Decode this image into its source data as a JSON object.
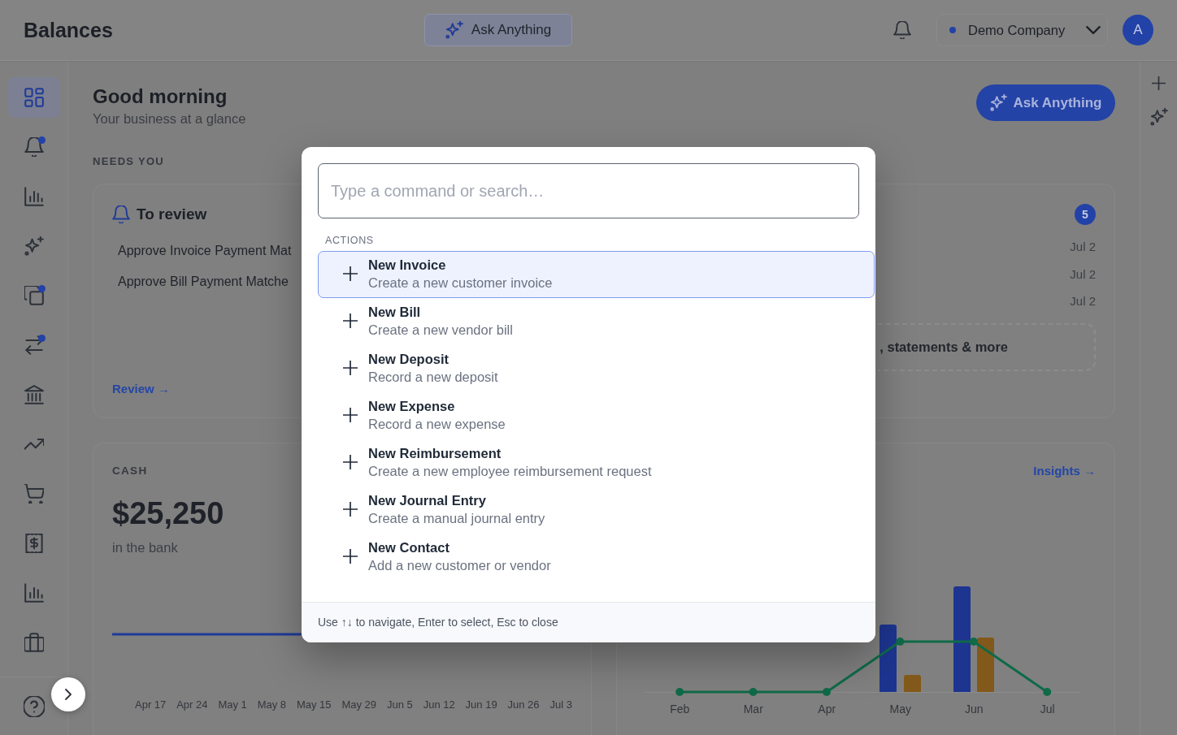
{
  "header": {
    "title": "Balances",
    "ask_button": "Ask Anything",
    "company_selector": "Demo Company",
    "avatar": "A"
  },
  "sidebar": {
    "items": [
      {
        "selected": true,
        "notification_dot": false
      },
      {
        "selected": false,
        "notification_dot": true
      },
      {
        "selected": false,
        "notification_dot": false
      },
      {
        "selected": false,
        "notification_dot": false
      },
      {
        "selected": false,
        "notification_dot": true
      },
      {
        "selected": false,
        "notification_dot": true
      },
      {
        "selected": false,
        "notification_dot": false
      },
      {
        "selected": false,
        "notification_dot": false
      },
      {
        "selected": false,
        "notification_dot": false
      },
      {
        "selected": false,
        "notification_dot": false
      },
      {
        "selected": false,
        "notification_dot": false
      },
      {
        "selected": false,
        "notification_dot": false
      }
    ]
  },
  "greeting": {
    "title": "Good morning",
    "subtitle": "Your business at a glance",
    "ask_button": "Ask Anything"
  },
  "needs_you": {
    "heading": "NEEDS YOU",
    "review_card": {
      "title": "To review",
      "items": [
        "Approve Invoice Payment Mat",
        "Approve Bill Payment Matche"
      ],
      "link": "Review →"
    },
    "card_2": {
      "badge": "5",
      "dates": [
        "Jul 2",
        "Jul 2",
        "Jul 2"
      ],
      "drop_zone_text": ", statements & more"
    }
  },
  "cash_card": {
    "label": "CASH",
    "amount": "$25,250",
    "caption": "in the bank",
    "x_labels": [
      "Apr 17",
      "Apr 24",
      "May 1",
      "May 8",
      "May 15",
      "May 29",
      "Jun 5",
      "Jun 12",
      "Jun 19",
      "Jun 26",
      "Jul 3"
    ]
  },
  "chart_card": {
    "link": "Insights →",
    "x_labels": [
      "Feb",
      "Mar",
      "Apr",
      "May",
      "Jun",
      "Jul"
    ]
  },
  "command_palette": {
    "placeholder": "Type a command or search…",
    "section": "ACTIONS",
    "items": [
      {
        "title": "New Invoice",
        "description": "Create a new customer invoice",
        "selected": true
      },
      {
        "title": "New Bill",
        "description": "Create a new vendor bill",
        "selected": false
      },
      {
        "title": "New Deposit",
        "description": "Record a new deposit",
        "selected": false
      },
      {
        "title": "New Expense",
        "description": "Record a new expense",
        "selected": false
      },
      {
        "title": "New Reimbursement",
        "description": "Create a new employee reimbursement request",
        "selected": false
      },
      {
        "title": "New Journal Entry",
        "description": "Create a manual journal entry",
        "selected": false
      },
      {
        "title": "New Contact",
        "description": "Add a new customer or vendor",
        "selected": false
      }
    ],
    "footer": "Use ↑↓ to navigate, Enter to select, Esc to close"
  }
}
